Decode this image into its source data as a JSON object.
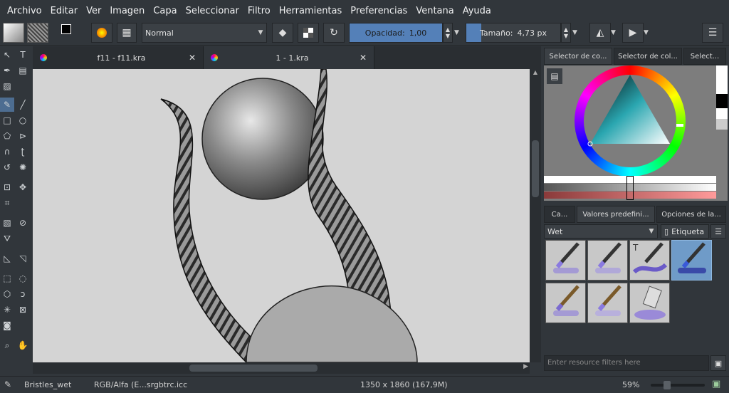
{
  "menu": [
    "Archivo",
    "Editar",
    "Ver",
    "Imagen",
    "Capa",
    "Seleccionar",
    "Filtro",
    "Herramientas",
    "Preferencias",
    "Ventana",
    "Ayuda"
  ],
  "toolbar": {
    "blend_mode": "Normal",
    "opacity_label": "Opacidad:",
    "opacity_value": "1,00",
    "size_label": "Tamaño:",
    "size_value": "4,73 px"
  },
  "tabs": [
    {
      "label": "f11 - f11.kra"
    },
    {
      "label": "1 - 1.kra"
    }
  ],
  "right_panel": {
    "top_tabs": [
      "Selector de co...",
      "Selector de col...",
      "Select..."
    ],
    "mid_tabs": [
      "Ca...",
      "Valores predefini...",
      "Opciones de la..."
    ],
    "preset_filter": "Wet",
    "tag_label": "Etiqueta",
    "search_placeholder": "Enter resource filters here"
  },
  "status": {
    "brush": "Bristles_wet",
    "color_profile": "RGB/Alfa (E...srgbtrc.icc",
    "dimensions": "1350 x 1860 (167,9M)",
    "zoom": "59%"
  },
  "colors": {
    "accent": "#5480b8",
    "dock_bg": "#31363b",
    "canvas_bg": "#d4d4d4"
  }
}
